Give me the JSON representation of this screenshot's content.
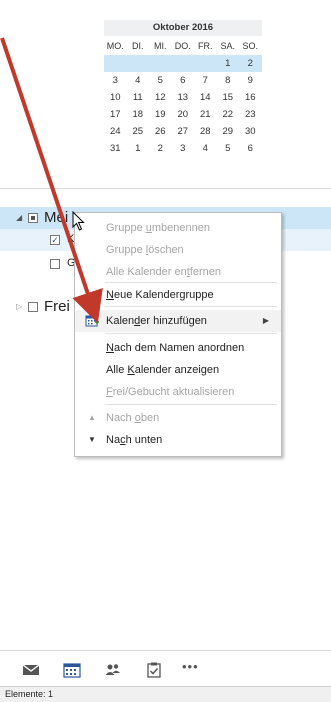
{
  "calendar": {
    "month_title": "Oktober 2016",
    "weekdays": [
      "MO.",
      "DI.",
      "MI.",
      "DO.",
      "FR.",
      "SA.",
      "SO."
    ],
    "weeks": [
      [
        "",
        "",
        "",
        "",
        "",
        "1",
        "2"
      ],
      [
        "3",
        "4",
        "5",
        "6",
        "7",
        "8",
        "9"
      ],
      [
        "10",
        "11",
        "12",
        "13",
        "14",
        "15",
        "16"
      ],
      [
        "17",
        "18",
        "19",
        "20",
        "21",
        "22",
        "23"
      ],
      [
        "24",
        "25",
        "26",
        "27",
        "28",
        "29",
        "30"
      ],
      [
        "31",
        "1",
        "2",
        "3",
        "4",
        "5",
        "6"
      ]
    ],
    "highlight_color": "#cde6f7"
  },
  "folders": {
    "group_mine_label": "Mei",
    "cal_item_1_letter": "K",
    "cal_item_2_letter": "G",
    "group_free_label": "Frei"
  },
  "context_menu": {
    "items": [
      {
        "pre": "Gruppe ",
        "u": "u",
        "post": "mbenennen",
        "disabled": true
      },
      {
        "pre": "Gruppe ",
        "u": "l",
        "post": "öschen",
        "disabled": true
      },
      {
        "pre": "Alle Kalender en",
        "u": "t",
        "post": "fernen",
        "disabled": true
      },
      {
        "pre": "",
        "u": "N",
        "post": "eue Kalendergruppe",
        "disabled": false
      },
      {
        "pre": "Kalen",
        "u": "d",
        "post": "er hinzufügen",
        "disabled": false,
        "has_submenu": true,
        "icon": "add-calendar-icon"
      },
      {
        "pre": "",
        "u": "N",
        "post": "ach dem Namen anordnen",
        "disabled": false
      },
      {
        "pre": "Alle ",
        "u": "K",
        "post": "alender anzeigen",
        "disabled": false
      },
      {
        "pre": "",
        "u": "F",
        "post": "rei/Gebucht aktualisieren",
        "disabled": true
      },
      {
        "pre": "Nach ",
        "u": "o",
        "post": "ben",
        "disabled": true,
        "icon": "arrow-up-icon"
      },
      {
        "pre": "Na",
        "u": "c",
        "post": "h unten",
        "disabled": false,
        "icon": "arrow-down-icon"
      }
    ]
  },
  "nav": {
    "icons": [
      "mail-icon",
      "calendar-icon",
      "people-icon",
      "tasks-icon",
      "more-icon"
    ],
    "more_glyph": "•••",
    "accent": "#2b579a"
  },
  "status_bar": {
    "text": "Elemente: 1"
  },
  "annotation_arrow_color": "#c0392b"
}
